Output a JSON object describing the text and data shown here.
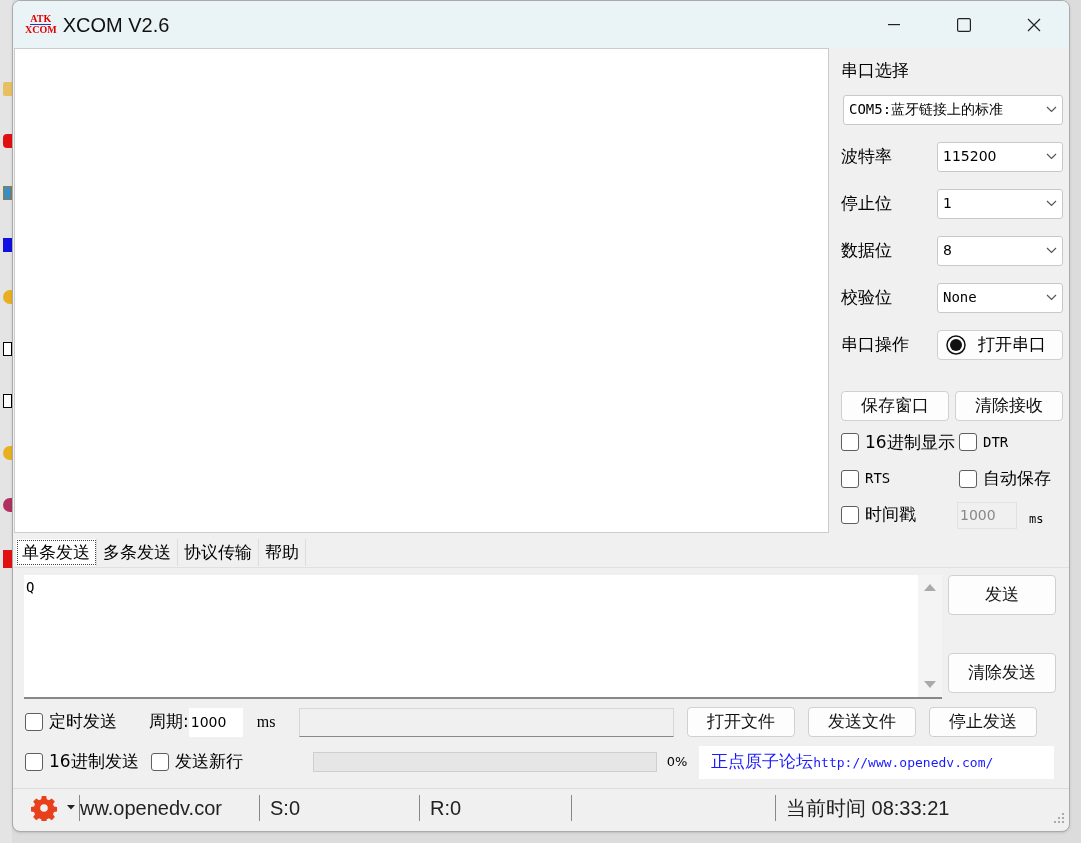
{
  "window": {
    "title": "XCOM V2.6",
    "logo": {
      "top": "ATK",
      "bottom": "XCOM"
    }
  },
  "serial_panel": {
    "port_label": "串口选择",
    "port_value": "COM5:蓝牙链接上的标准",
    "settings": [
      {
        "label": "波特率",
        "value": "115200"
      },
      {
        "label": "停止位",
        "value": "1"
      },
      {
        "label": "数据位",
        "value": "8"
      },
      {
        "label": "校验位",
        "value": "None"
      }
    ],
    "operation_label": "串口操作",
    "open_button": "打开串口",
    "port_open": false,
    "buttons": [
      "保存窗口",
      "清除接收"
    ],
    "options": [
      {
        "label": "16进制显示",
        "checked": false
      },
      {
        "label": "DTR",
        "checked": false
      },
      {
        "label": "RTS",
        "checked": false
      },
      {
        "label": "自动保存",
        "checked": false
      }
    ],
    "timestamp": {
      "label": "时间戳",
      "checked": false,
      "value": "1000",
      "disabled": true,
      "unit": "ms"
    }
  },
  "tabs": [
    {
      "label": "单条发送",
      "selected": true
    },
    {
      "label": "多条发送",
      "selected": false
    },
    {
      "label": "协议传输",
      "selected": false
    },
    {
      "label": "帮助",
      "selected": false
    }
  ],
  "send_area": {
    "value": "Q"
  },
  "send_buttons": [
    "发送",
    "清除发送"
  ],
  "timed_send": {
    "label": "定时发送",
    "checked": false,
    "period_label": "周期:",
    "period_value": "1000",
    "unit": "ms"
  },
  "send_options": [
    {
      "label": "16进制发送",
      "checked": false
    },
    {
      "label": "发送新行",
      "checked": false
    }
  ],
  "file_buttons": [
    "打开文件",
    "发送文件",
    "停止发送"
  ],
  "progress": {
    "level": 0,
    "reading": "0%"
  },
  "forum_link": {
    "label": "正点原子论坛",
    "url": "http://www.openedv.com/"
  },
  "status_bar": {
    "url": "ww.openedv.cor",
    "sent": "S:0",
    "received": "R:0",
    "time": "当前时间 08:33:21"
  }
}
